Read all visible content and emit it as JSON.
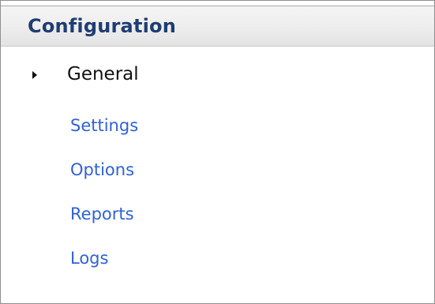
{
  "panel": {
    "title": "Configuration",
    "section": {
      "label": "General",
      "expander_icon": "triangle-right-icon",
      "links": [
        {
          "label": "Settings"
        },
        {
          "label": "Options"
        },
        {
          "label": "Reports"
        },
        {
          "label": "Logs"
        }
      ]
    }
  },
  "colors": {
    "title": "#1f3d73",
    "link": "#2f62d6",
    "border": "#8f8f8f"
  }
}
